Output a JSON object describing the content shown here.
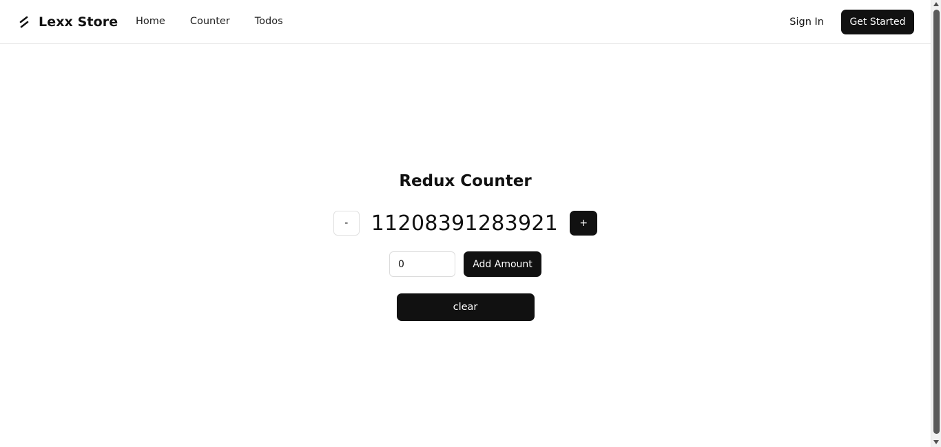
{
  "header": {
    "brand": "Lexx Store",
    "brand_icon": "lightning-slash-icon",
    "nav": [
      {
        "label": "Home"
      },
      {
        "label": "Counter"
      },
      {
        "label": "Todos"
      }
    ],
    "sign_in_label": "Sign In",
    "get_started_label": "Get Started"
  },
  "counter": {
    "title": "Redux Counter",
    "decrement_label": "-",
    "value": "11208391283921",
    "increment_label": "+",
    "amount_input_value": "0",
    "add_amount_label": "Add Amount",
    "clear_label": "clear"
  },
  "colors": {
    "accent": "#111111",
    "background": "#ffffff",
    "border": "#e6e6e6"
  }
}
